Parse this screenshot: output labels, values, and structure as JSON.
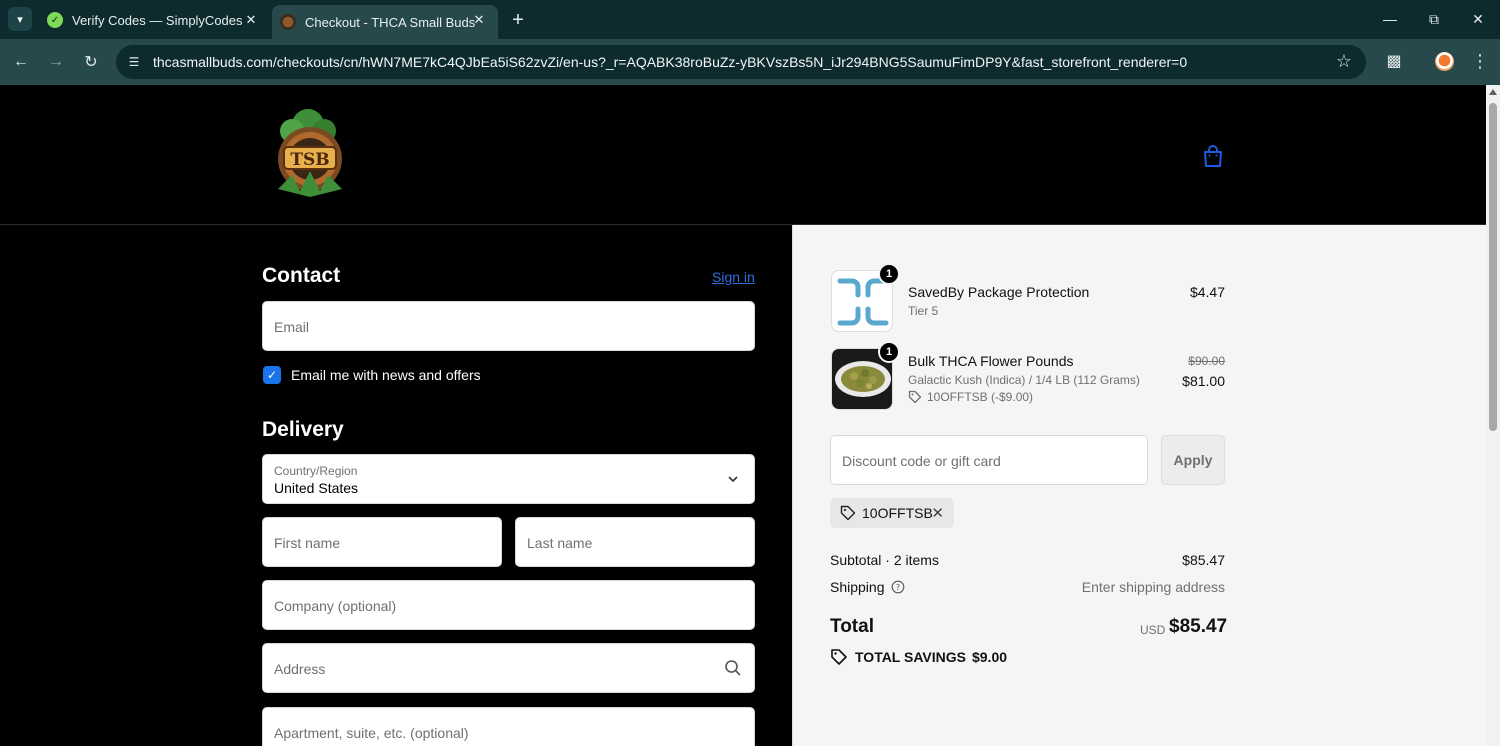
{
  "browser": {
    "tabs": [
      {
        "title": "Verify Codes — SimplyCodes",
        "favicon": "simplycodes-icon",
        "active": false
      },
      {
        "title": "Checkout - THCA Small Buds",
        "favicon": "tsb-icon",
        "active": true
      }
    ],
    "url": "thcasmallbuds.com/checkouts/cn/hWN7ME7kC4QJbEa5iS62zvZi/en-us?_r=AQABK38roBuZz-yBKVszBs5N_iJr294BNG5SaumuFimDP9Y&fast_storefront_renderer=0",
    "colors": {
      "frame": "#0d2b2f",
      "toolbar": "#28494c"
    }
  },
  "header": {
    "logo_text": "TSB"
  },
  "contact": {
    "title": "Contact",
    "signin": "Sign in",
    "email_placeholder": "Email",
    "newsletter_label": "Email me with news and offers",
    "newsletter_checked": true
  },
  "delivery": {
    "title": "Delivery",
    "country_label": "Country/Region",
    "country_value": "United States",
    "first_name_placeholder": "First name",
    "last_name_placeholder": "Last name",
    "company_placeholder": "Company (optional)",
    "address_placeholder": "Address",
    "apartment_placeholder": "Apartment, suite, etc. (optional)"
  },
  "summary": {
    "items": [
      {
        "qty": "1",
        "name": "SavedBy Package Protection",
        "variant": "Tier 5",
        "price": "$4.47"
      },
      {
        "qty": "1",
        "name": "Bulk THCA Flower Pounds",
        "variant": "Galactic Kush (Indica) / 1/4 LB (112 Grams)",
        "discount": "10OFFTSB (-$9.00)",
        "original_price": "$90.00",
        "price": "$81.00"
      }
    ],
    "discount_placeholder": "Discount code or gift card",
    "apply_label": "Apply",
    "applied_code": "10OFFTSB",
    "subtotal_label": "Subtotal · 2 items",
    "subtotal_value": "$85.47",
    "shipping_label": "Shipping",
    "shipping_value": "Enter shipping address",
    "total_label": "Total",
    "currency": "USD",
    "total_value": "$85.47",
    "savings_label": "TOTAL SAVINGS",
    "savings_value": "$9.00"
  }
}
